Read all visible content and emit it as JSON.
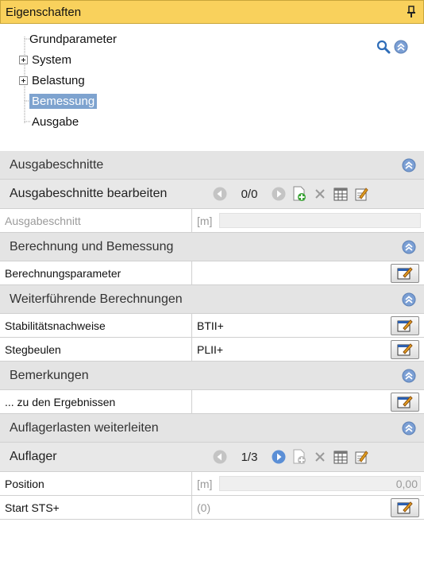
{
  "panel": {
    "title": "Eigenschaften"
  },
  "tree": {
    "items": [
      {
        "label": "Grundparameter",
        "expandable": false,
        "selected": false
      },
      {
        "label": "System",
        "expandable": true,
        "selected": false
      },
      {
        "label": "Belastung",
        "expandable": true,
        "selected": false
      },
      {
        "label": "Bemessung",
        "expandable": false,
        "selected": true
      },
      {
        "label": "Ausgabe",
        "expandable": false,
        "selected": false
      }
    ]
  },
  "sections": {
    "ausgabeschnitte": {
      "title": "Ausgabeschnitte",
      "subhead": "Ausgabeschnitte bearbeiten",
      "counter": "0/0",
      "row_label": "Ausgabeschnitt",
      "row_unit": "[m]"
    },
    "berechnung": {
      "title": "Berechnung und Bemessung",
      "row_label": "Berechnungsparameter"
    },
    "weiterfuehrend": {
      "title": "Weiterführende Berechnungen",
      "rows": [
        {
          "label": "Stabilitätsnachweise",
          "value": "BTII+"
        },
        {
          "label": "Stegbeulen",
          "value": "PLII+"
        }
      ]
    },
    "bemerkungen": {
      "title": "Bemerkungen",
      "row_label": "... zu den Ergebnissen"
    },
    "auflager": {
      "title": "Auflagerlasten weiterleiten",
      "subhead": "Auflager",
      "counter": "1/3",
      "position_label": "Position",
      "position_unit": "[m]",
      "position_value": "0,00",
      "start_label": "Start STS+",
      "start_value": "(0)"
    }
  },
  "colors": {
    "title_bar": "#f9d15c",
    "selection": "#7ea3cf",
    "section_bg": "#e4e4e4",
    "collapse_icon": "#7b9fd4"
  }
}
